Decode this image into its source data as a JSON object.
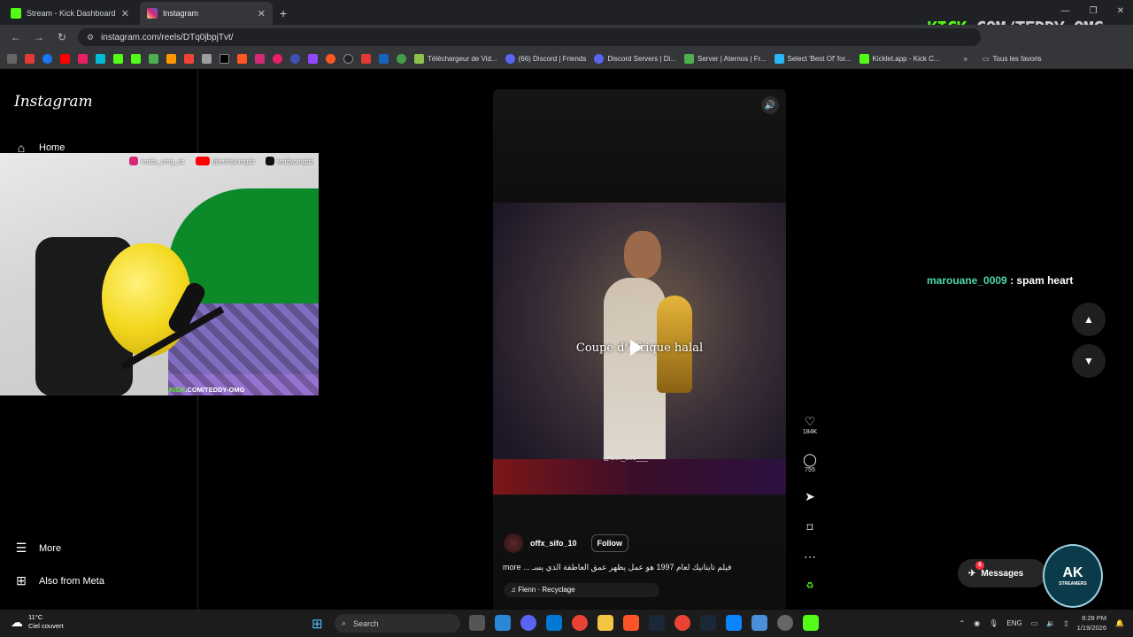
{
  "browser": {
    "tabs": [
      {
        "title": "Stream - Kick Dashboard",
        "icon": "kick-icon",
        "color": "#53fc18"
      },
      {
        "title": "Instagram",
        "icon": "instagram-icon",
        "color": "#d62976"
      }
    ],
    "new_tab": "+",
    "url": "instagram.com/reels/DTq0jbpjTvt/",
    "bookmarks": [
      {
        "label": "Téléchargeur de Vid...",
        "color": "#8bc34a"
      },
      {
        "label": "(66) Discord | Friends",
        "color": "#5865f2"
      },
      {
        "label": "Discord Servers | Di...",
        "color": "#5865f2"
      },
      {
        "label": "Server | Aternos | Fr...",
        "color": "#4caf50"
      },
      {
        "label": "Select 'Best Of' for...",
        "color": "#29b6f6"
      },
      {
        "label": "Kicklet.app - Kick C...",
        "color": "#53fc18"
      }
    ],
    "all_bookmarks": "Tous les favoris"
  },
  "overlay": {
    "kick_green": "KICK",
    "kick_white": ".COM/TEDDY-OMG"
  },
  "sidebar": {
    "logo": "Instagram",
    "home": "Home",
    "more": "More",
    "meta": "Also from Meta"
  },
  "webcam": {
    "instagram_handle": "teddy_omg_dz",
    "youtube_handle": "@teddyomgdz",
    "tiktok_handle": "teddyomgdz",
    "watermark_green": "KICK",
    "watermark_white": ".COM/TEDDY-OMG"
  },
  "reel": {
    "caption": "Coupe d'Afrique halal",
    "watermark": "@offx_sifo___",
    "author": "offx_sifo_10",
    "follow": "Follow",
    "description": "more ... فيلم تايتانيك لعام 1997 هو عمل يظهر عمق العاطفة الذي يسـ",
    "audio": "♫ Flenn · Recyclage",
    "likes": "184K",
    "comments": "755"
  },
  "chat": {
    "user": "marouane_0009",
    "message": " : spam heart"
  },
  "messages": {
    "label": "Messages",
    "badge": "6"
  },
  "brand_logo": {
    "title": "AK",
    "subtitle": "STREAMERS"
  },
  "taskbar": {
    "temp": "11°C",
    "weather": "Ciel couvert",
    "search": "Search",
    "lang": "ENG",
    "time": "8:28 PM",
    "date": "1/19/2026"
  },
  "colors": {
    "kick_green": "#53fc18",
    "chat_user": "#4fd6b0",
    "badge_red": "#ff3040"
  }
}
